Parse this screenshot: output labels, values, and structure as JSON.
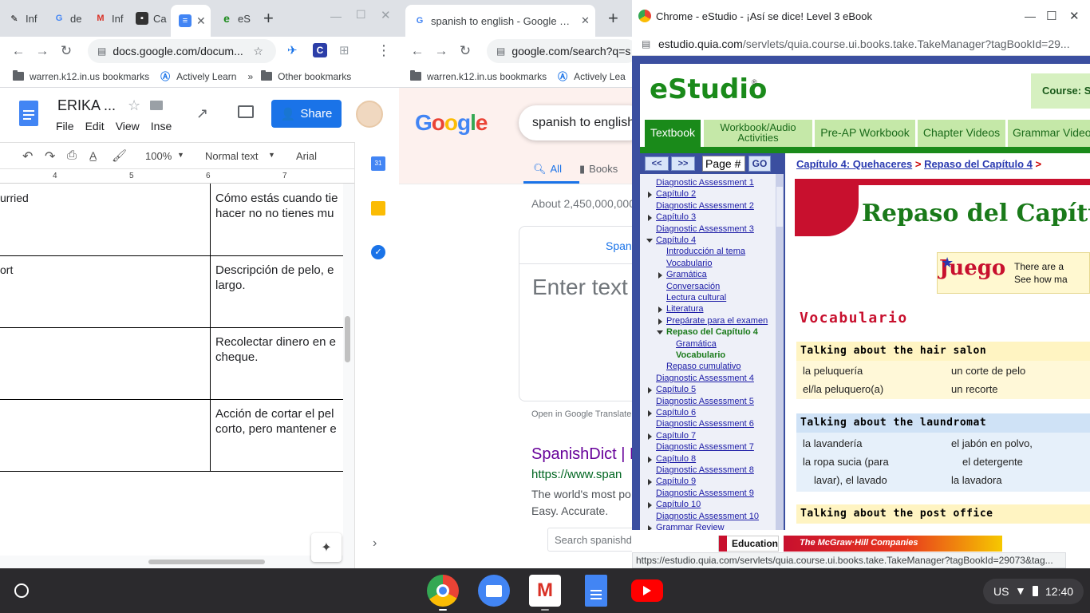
{
  "win1": {
    "tabs": [
      "Inf",
      "de",
      "Inf",
      "Ca",
      "",
      "eS"
    ],
    "url": "docs.google.com/docum...",
    "bookmarks": [
      "warren.k12.in.us bookmarks",
      "Actively Learn",
      "Other bookmarks"
    ],
    "docs": {
      "title": "ERIKA ...",
      "menu": [
        "File",
        "Edit",
        "View",
        "Inse"
      ],
      "share_label": "Share",
      "zoom": "100%",
      "style": "Normal text",
      "font": "Arial",
      "ruler": [
        "4",
        "5",
        "6",
        "7"
      ],
      "rows": [
        {
          "left": "urried",
          "right": "Cómo estás cuando tie hacer no no tienes mu"
        },
        {
          "left": "ort",
          "right": "Descripción de pelo, e largo."
        },
        {
          "left": "",
          "right": "Recolectar dinero en e cheque."
        },
        {
          "left": "",
          "right": "Acción de cortar el pel corto, pero mantener e"
        }
      ]
    }
  },
  "win2": {
    "tab_title": "spanish to english - Google Search",
    "url": "google.com/search?q=s",
    "bookmarks": [
      "warren.k12.in.us bookmarks",
      "Actively Lea"
    ],
    "query": "spanish to english",
    "tabs": [
      "All",
      "Books"
    ],
    "result_count": "About 2,450,000,000",
    "translate_lang": "Span",
    "translate_placeholder": "Enter text",
    "open_translate": "Open in Google Translate",
    "result_title": "SpanishDict | E",
    "result_url": "https://www.span",
    "result_snippet": "The world's most po Easy. Accurate.",
    "search_box": "Search spanishd"
  },
  "win3": {
    "title": "Chrome - eStudio - ¡Así se dice! Level 3 eBook",
    "url_host": "estudio.quia.com",
    "url_path": "/servlets/quia.course.ui.books.take.TakeManager?tagBookId=29...",
    "logo": "eStudio",
    "course_label": "Course: S",
    "tabs": [
      "Textbook",
      "Workbook/Audio Activities",
      "Pre-AP Workbook",
      "Chapter Videos",
      "Grammar Video"
    ],
    "prev": "<<",
    "next": ">>",
    "page_placeholder": "Page #",
    "go": "GO",
    "breadcrumb": [
      "Capítulo 4: Quehaceres",
      ">",
      "Repaso del Capítulo 4",
      ">"
    ],
    "nav": [
      "Diagnostic Assessment 1",
      "Capítulo 2",
      "Diagnostic Assessment 2",
      "Capítulo 3",
      "Diagnostic Assessment 3",
      "Capítulo 4",
      "Introducción al tema",
      "Vocabulario",
      "Gramática",
      "Conversación",
      "Lectura cultural",
      "Literatura",
      "Prepárate para el examen",
      "Repaso del Capítulo 4",
      "Gramática",
      "Vocabulario",
      "Repaso cumulativo",
      "Diagnostic Assessment 4",
      "Capítulo 5",
      "Diagnostic Assessment 5",
      "Capítulo 6",
      "Diagnostic Assessment 6",
      "Capítulo 7",
      "Diagnostic Assessment 7",
      "Capítulo 8",
      "Diagnostic Assessment 8",
      "Capítulo 9",
      "Diagnostic Assessment 9",
      "Capítulo 10",
      "Diagnostic Assessment 10",
      "Grammar Review"
    ],
    "banner": "Repaso del Capítu",
    "juego": "Juego",
    "juego_text": [
      "There are a",
      "See how ma"
    ],
    "section": "Vocabulario",
    "groups": [
      {
        "title": "Talking about the hair salon",
        "left": [
          "la peluquería",
          "el/la peluquero(a)"
        ],
        "right": [
          "un corte de pelo",
          "un recorte"
        ]
      },
      {
        "title": "Talking about the laundromat",
        "left": [
          "la lavandería",
          "la ropa sucia (para",
          "lavar), el lavado"
        ],
        "right": [
          "el jabón en polvo,",
          "el detergente",
          "la lavadora"
        ]
      },
      {
        "title": "Talking about the post office"
      }
    ],
    "footer_edu": "Education",
    "footer_mh": "The McGraw·Hill Companies",
    "status_url": "https://estudio.quia.com/servlets/quia.course.ui.books.take.TakeManager?tagBookId=29073&tag..."
  },
  "shelf": {
    "locale": "US",
    "time": "12:40"
  },
  "colors": {
    "accent": "#1a73e8",
    "estudio_blue": "#3b4fa0",
    "estudio_green": "#1a8a1a"
  }
}
